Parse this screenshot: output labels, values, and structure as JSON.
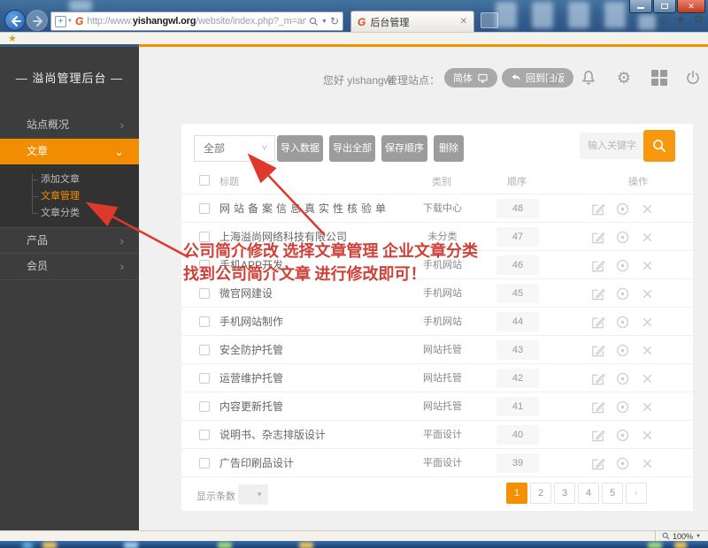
{
  "browser": {
    "url": {
      "prefix": "http://www.",
      "domain": "yishangwl.org",
      "path": "/website/index.php?_m=article&_a=admin_list&sessi"
    },
    "tab_title": "后台管理",
    "zoom_label": "100%"
  },
  "header": {
    "greeting": "您好 yishangwl",
    "site_label": "管理站点：",
    "lang_button": "简体",
    "back_to_old": "回到旧版"
  },
  "sidebar": {
    "logo": "— 溢尚管理后台 —",
    "items": [
      {
        "label": "站点概况"
      },
      {
        "label": "文章"
      },
      {
        "label": "产品"
      },
      {
        "label": "会员"
      }
    ],
    "submenu": [
      {
        "label": "添加文章"
      },
      {
        "label": "文章管理"
      },
      {
        "label": "文章分类"
      }
    ]
  },
  "toolbar": {
    "filter_value": "全部",
    "buttons": [
      "导入数据",
      "导出全部",
      "保存顺序",
      "删除"
    ],
    "search_placeholder": "输入关键字"
  },
  "table": {
    "headers": [
      "标题",
      "类别",
      "顺序",
      "操作"
    ],
    "rows": [
      {
        "title": "网站备案信息真实性核验单",
        "category": "下载中心",
        "order": "48"
      },
      {
        "title": "上海溢尚网络科技有限公司",
        "category": "未分类",
        "order": "47"
      },
      {
        "title": "手机APP开发",
        "category": "手机网站",
        "order": "46"
      },
      {
        "title": "微官网建设",
        "category": "手机网站",
        "order": "45"
      },
      {
        "title": "手机网站制作",
        "category": "手机网站",
        "order": "44"
      },
      {
        "title": "安全防护托管",
        "category": "网站托管",
        "order": "43"
      },
      {
        "title": "运营维护托管",
        "category": "网站托管",
        "order": "42"
      },
      {
        "title": "内容更新托管",
        "category": "网站托管",
        "order": "41"
      },
      {
        "title": "说明书、杂志排版设计",
        "category": "平面设计",
        "order": "40"
      },
      {
        "title": "广告印刷品设计",
        "category": "平面设计",
        "order": "39"
      }
    ]
  },
  "footer": {
    "per_page_label": "显示条数",
    "pages": [
      "1",
      "2",
      "3",
      "4",
      "5"
    ]
  },
  "annotation": {
    "line1": "公司简介修改  选择文章管理  企业文章分类",
    "line2": "找到公司简介文章 进行修改即可！"
  },
  "colors": {
    "accent": "#F39100",
    "annotation_red": "#CF4038"
  }
}
